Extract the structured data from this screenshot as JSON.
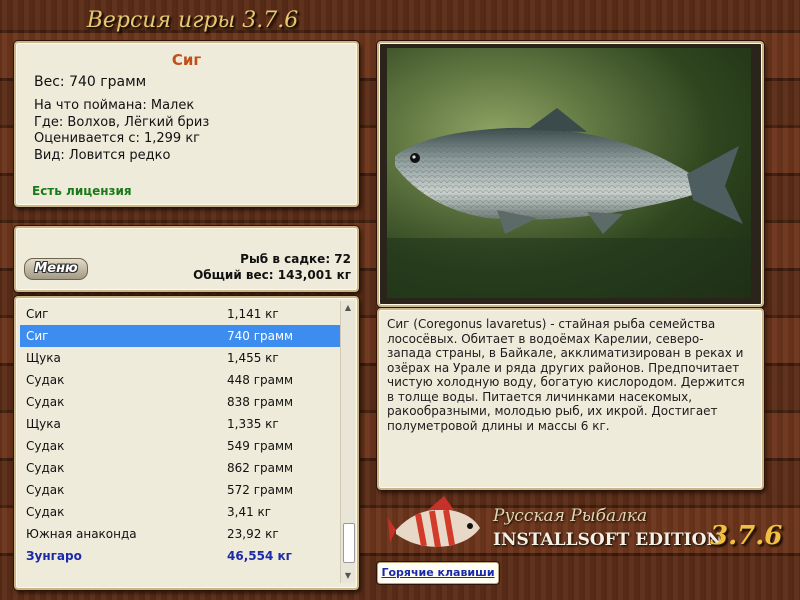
{
  "title": "Версия игры 3.7.6",
  "info": {
    "fish_name": "Сиг",
    "weight": "Вес: 740 грамм",
    "bait": "На что поймана: Малек",
    "location": "Где: Волхов, Лёгкий бриз",
    "value": "Оценивается с: 1,299 кг",
    "rarity": "Вид: Ловится редко",
    "license": "Есть лицензия"
  },
  "stats": {
    "menu_label": "Меню",
    "fish_count": "Рыб в садке: 72",
    "total_weight": "Общий вес: 143,001 кг"
  },
  "catch_list": [
    {
      "name": "Сиг",
      "weight": "1,141 кг"
    },
    {
      "name": "Сиг",
      "weight": "740 грамм"
    },
    {
      "name": "Щука",
      "weight": "1,455 кг"
    },
    {
      "name": "Судак",
      "weight": "448 грамм"
    },
    {
      "name": "Судак",
      "weight": "838 грамм"
    },
    {
      "name": "Щука",
      "weight": "1,335 кг"
    },
    {
      "name": "Судак",
      "weight": "549 грамм"
    },
    {
      "name": "Судак",
      "weight": "862 грамм"
    },
    {
      "name": "Судак",
      "weight": "572 грамм"
    },
    {
      "name": "Судак",
      "weight": "3,41 кг"
    },
    {
      "name": "Южная анаконда",
      "weight": "23,92 кг"
    },
    {
      "name": "Зунгаро",
      "weight": "46,554 кг"
    }
  ],
  "description": "Сиг (Coregonus lavaretus) - стайная рыба семейства лососёвых. Обитает в водоёмах Карелии, северо-запада страны, в Байкале, акклиматизирован в реках и озёрах на Урале и ряда других районов. Предпочитает чистую холодную воду, богатую кислородом. Держится в толще воды. Питается личинками насекомых, ракообразными, молодью рыб, их икрой. Достигает полуметровой длины и массы 6 кг.",
  "brand": {
    "line1": "Русская Рыбалка",
    "line2": "INSTALLSOFT EDITION",
    "version": "3.7.6"
  },
  "hotkeys_label": "Горячие клавиши",
  "colors": {
    "fish_name": "#c0501a",
    "license": "#1a7a1a",
    "selected_row": "#3d8df0",
    "total_row": "#1a2aa8"
  },
  "icons": {
    "scroll_up": "chevron-up-icon",
    "scroll_down": "chevron-down-icon"
  }
}
